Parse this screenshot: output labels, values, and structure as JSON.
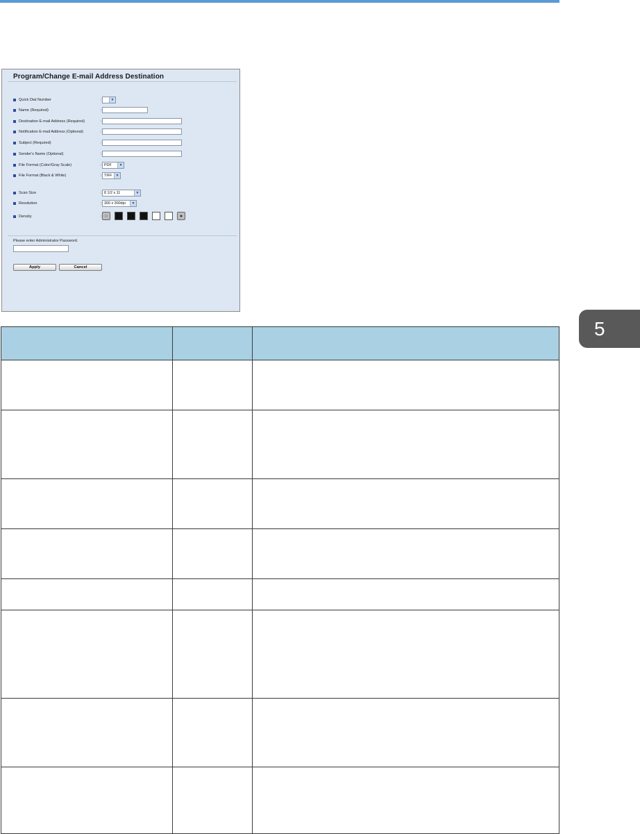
{
  "chapter_tab": "5",
  "screenshot": {
    "title": "Program/Change E-mail Address Destination",
    "fields": [
      {
        "label": "Quick Dial Number",
        "control": "select",
        "value": "",
        "width": 20
      },
      {
        "label": "Name (Required)",
        "control": "input",
        "width": 66
      },
      {
        "label": "Destination E-mail Address (Required)",
        "control": "input",
        "width": 115
      },
      {
        "label": "Notification E-mail Address (Optional)",
        "control": "input",
        "width": 115
      },
      {
        "label": "Subject (Required)",
        "control": "input",
        "width": 115
      },
      {
        "label": "Sender's Name (Optional)",
        "control": "input",
        "width": 115
      },
      {
        "label": "File Format (Color/Gray Scale)",
        "control": "select",
        "value": "PDF",
        "width": 32
      },
      {
        "label": "File Format (Black & White)",
        "control": "select",
        "value": "TIFF",
        "width": 27
      },
      {
        "label": "Scan Size",
        "control": "select",
        "value": "8 1/2 x 11",
        "width": 56
      },
      {
        "label": "Resolution",
        "control": "select",
        "value": "300 x 300dpi",
        "width": 50
      },
      {
        "label": "Density",
        "control": "density",
        "levels": [
          "black",
          "black",
          "black",
          "white",
          "white"
        ]
      }
    ],
    "password_label": "Please enter Administrator Password.",
    "apply_label": "Apply",
    "cancel_label": "Cancel"
  },
  "table": {
    "header": [
      "",
      "",
      ""
    ],
    "rows": [
      [
        "",
        "",
        ""
      ],
      [
        "",
        "",
        ""
      ],
      [
        "",
        "",
        ""
      ],
      [
        "",
        "",
        ""
      ],
      [
        "",
        "",
        ""
      ],
      [
        "",
        "",
        ""
      ],
      [
        "",
        "",
        ""
      ],
      [
        "",
        "",
        ""
      ]
    ]
  },
  "colors": {
    "accent_rule": "#5b9bd5",
    "panel_background": "#dde7f3",
    "table_header": "#a9d0e3",
    "chapter_tab": "#595959"
  }
}
